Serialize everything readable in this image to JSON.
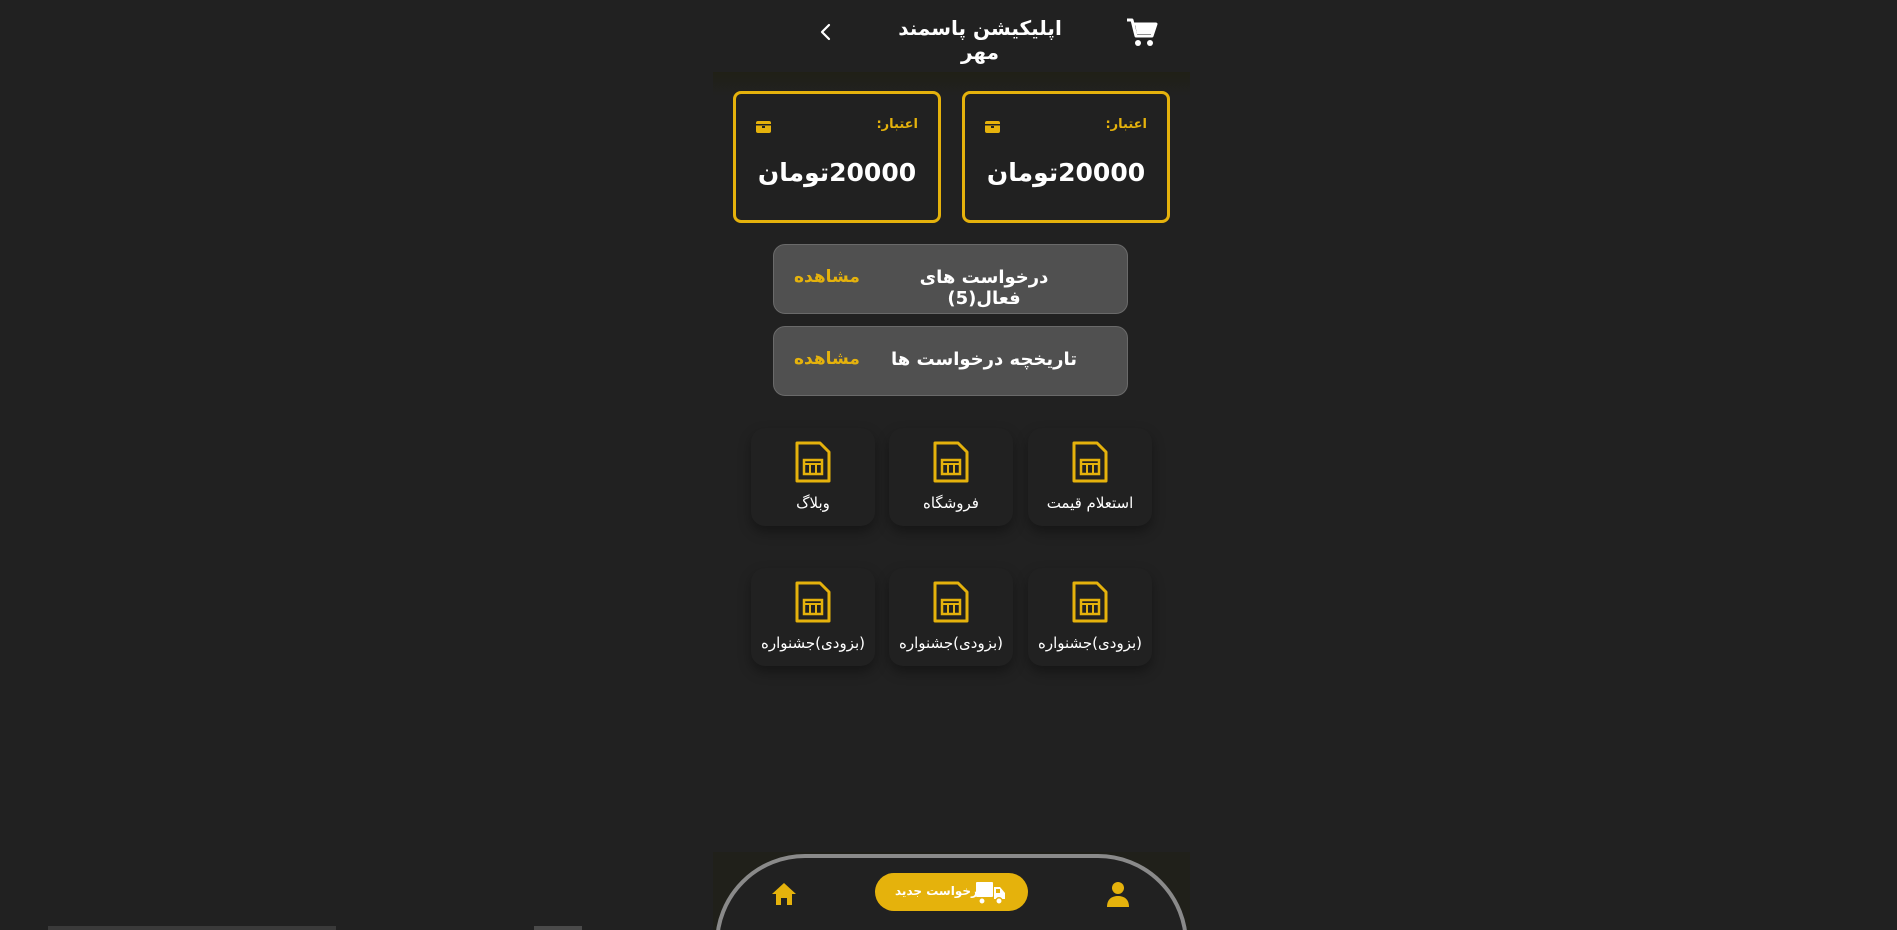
{
  "header": {
    "title": "اپلیکیشن پاسمند مهر",
    "back_icon": "chevron-right-icon",
    "cart_icon": "cart-icon"
  },
  "credits": [
    {
      "label": "اعتبار:",
      "amount": "20000تومان",
      "icon": "wallet-icon"
    },
    {
      "label": "اعتبار:",
      "amount": "20000تومان",
      "icon": "wallet-icon"
    }
  ],
  "requests": {
    "active": {
      "title": "درخواست های فعال(5)",
      "action": "مشاهده"
    },
    "history": {
      "title": "تاریخچه درخواست ها",
      "action": "مشاهده"
    }
  },
  "tiles": [
    {
      "label": "استعلام قیمت",
      "icon": "sim-card-icon"
    },
    {
      "label": "فروشگاه",
      "icon": "sim-card-icon"
    },
    {
      "label": "وبلاگ",
      "icon": "sim-card-icon"
    },
    {
      "label": "(بزودی)جشنواره",
      "icon": "sim-card-icon"
    },
    {
      "label": "(بزودی)جشنواره",
      "icon": "sim-card-icon"
    },
    {
      "label": "(بزودی)جشنواره",
      "icon": "sim-card-icon"
    }
  ],
  "bottom_nav": {
    "new_request_label": "درخواست جدید",
    "home_icon": "home-icon",
    "profile_icon": "user-icon",
    "truck_icon": "truck-icon"
  },
  "colors": {
    "background": "#212121",
    "accent": "#e5b20c",
    "row_background": "#505050",
    "nav_border": "#8a8a8a"
  }
}
